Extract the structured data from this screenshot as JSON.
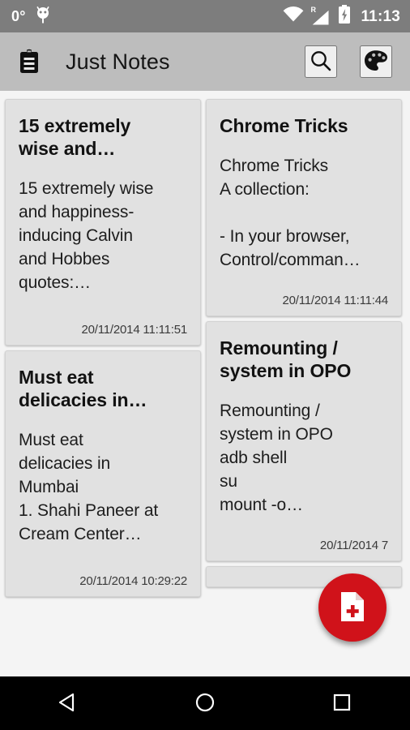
{
  "status_bar": {
    "temperature": "0°",
    "time": "11:13",
    "icons": [
      "android-head-icon",
      "wifi-icon",
      "signal-roaming-icon",
      "battery-charging-icon"
    ],
    "roaming_label": "R",
    "background_color": "#7d7d7d",
    "foreground_color": "#ffffff"
  },
  "app_bar": {
    "title": "Just Notes",
    "app_icon": "clipboard-notes-icon",
    "search_label": "Search",
    "theme_label": "Theme",
    "background_color": "#bdbdbd",
    "title_color": "#151515"
  },
  "notes": {
    "background_color": "#f4f4f4",
    "card_color": "#e1e1e1",
    "left_column": [
      {
        "title": "15 extremely\nwise and…",
        "body": "15 extremely wise\nand happiness-\ninducing Calvin\nand Hobbes\nquotes:…",
        "date": "20/11/2014 11:11:51"
      },
      {
        "title": "Must eat\ndelicacies in…",
        "body": "Must eat\ndelicacies in\nMumbai\n1. Shahi Paneer at\nCream Center…",
        "date": "20/11/2014 10:29:22"
      }
    ],
    "right_column": [
      {
        "title": "Chrome Tricks",
        "body": "Chrome Tricks\nA collection:\n\n- In your browser,\nControl/comman…",
        "date": "20/11/2014 11:11:44"
      },
      {
        "title": "Remounting /\nsystem in OPO",
        "body": "Remounting /\nsystem in OPO\n adb shell\n su\n  mount -o…",
        "date": "20/11/2014             7"
      }
    ]
  },
  "fab": {
    "label": "New note",
    "icon": "new-document-icon",
    "color": "#d0121a"
  },
  "nav_bar": {
    "back_label": "Back",
    "home_label": "Home",
    "recents_label": "Recents",
    "background_color": "#000000"
  }
}
